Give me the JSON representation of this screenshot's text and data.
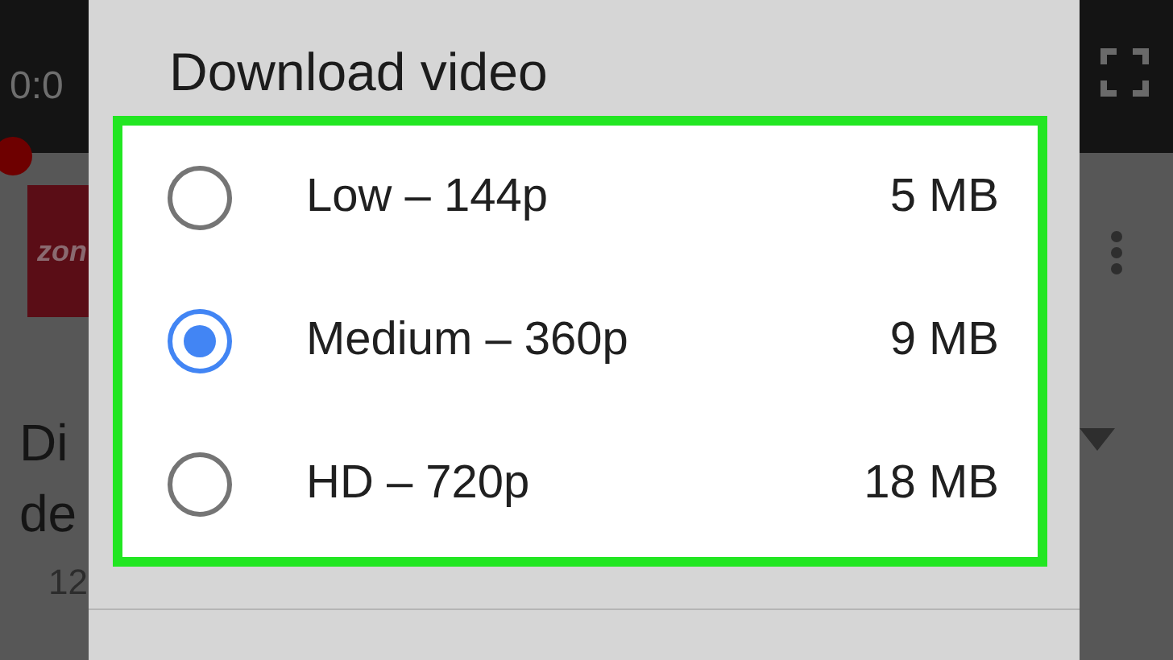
{
  "background_app": {
    "player_time": "0:0",
    "channel_logo_text": "zon",
    "video_title_lines": [
      "Di",
      "de"
    ],
    "video_meta": "12"
  },
  "dialog": {
    "title": "Download video",
    "options": [
      {
        "label": "Low – 144p",
        "size": "5 MB",
        "selected": false
      },
      {
        "label": "Medium – 360p",
        "size": "9 MB",
        "selected": true
      },
      {
        "label": "HD – 720p",
        "size": "18 MB",
        "selected": false
      }
    ]
  }
}
